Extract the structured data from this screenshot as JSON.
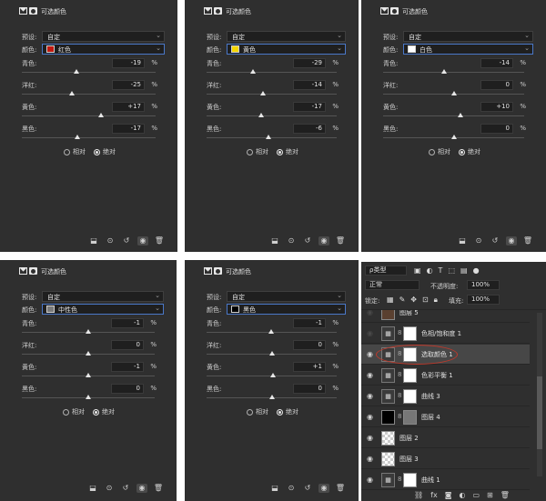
{
  "panels": [
    {
      "title": "可选颜色",
      "preset_label": "预设:",
      "preset_value": "自定",
      "color_label": "颜色:",
      "color_value": "红色",
      "swatch": "#c2180f",
      "sliders": [
        {
          "name": "青色:",
          "value": "-19",
          "pct": "%",
          "level": -19
        },
        {
          "name": "洋红:",
          "value": "-25",
          "pct": "%",
          "level": -25
        },
        {
          "name": "黄色:",
          "value": "+17",
          "pct": "%",
          "level": 17
        },
        {
          "name": "黑色:",
          "value": "-17",
          "pct": "%",
          "level": -17
        }
      ],
      "relative": "相对",
      "absolute": "绝对"
    },
    {
      "title": "可选颜色",
      "preset_label": "预设:",
      "preset_value": "自定",
      "color_label": "颜色:",
      "color_value": "黄色",
      "swatch": "#f4d600",
      "sliders": [
        {
          "name": "青色:",
          "value": "-29",
          "pct": "%",
          "level": -29
        },
        {
          "name": "洋红:",
          "value": "-14",
          "pct": "%",
          "level": -14
        },
        {
          "name": "黄色:",
          "value": "-17",
          "pct": "%",
          "level": -17
        },
        {
          "name": "黑色:",
          "value": "-6",
          "pct": "%",
          "level": -6
        }
      ],
      "relative": "相对",
      "absolute": "绝对"
    },
    {
      "title": "可选颜色",
      "preset_label": "预设:",
      "preset_value": "自定",
      "color_label": "颜色:",
      "color_value": "白色",
      "swatch": "#ffffff",
      "sliders": [
        {
          "name": "青色:",
          "value": "-14",
          "pct": "%",
          "level": -14
        },
        {
          "name": "洋红:",
          "value": "0",
          "pct": "%",
          "level": 0
        },
        {
          "name": "黄色:",
          "value": "+10",
          "pct": "%",
          "level": 10
        },
        {
          "name": "黑色:",
          "value": "0",
          "pct": "%",
          "level": 0
        }
      ],
      "relative": "相对",
      "absolute": "绝对"
    },
    {
      "title": "可选颜色",
      "preset_label": "预设:",
      "preset_value": "自定",
      "color_label": "颜色:",
      "color_value": "中性色",
      "swatch": "#7a7a7a",
      "sliders": [
        {
          "name": "青色:",
          "value": "-1",
          "pct": "%",
          "level": -1
        },
        {
          "name": "洋红:",
          "value": "0",
          "pct": "%",
          "level": 0
        },
        {
          "name": "黄色:",
          "value": "-1",
          "pct": "%",
          "level": -1
        },
        {
          "name": "黑色:",
          "value": "0",
          "pct": "%",
          "level": 0
        }
      ],
      "relative": "相对",
      "absolute": "绝对"
    },
    {
      "title": "可选颜色",
      "preset_label": "预设:",
      "preset_value": "自定",
      "color_label": "颜色:",
      "color_value": "黑色",
      "swatch": "#000000",
      "sliders": [
        {
          "name": "青色:",
          "value": "-1",
          "pct": "%",
          "level": -1
        },
        {
          "name": "洋红:",
          "value": "0",
          "pct": "%",
          "level": 0
        },
        {
          "name": "黄色:",
          "value": "+1",
          "pct": "%",
          "level": 1
        },
        {
          "name": "黑色:",
          "value": "0",
          "pct": "%",
          "level": 0
        }
      ],
      "relative": "相对",
      "absolute": "绝对"
    }
  ],
  "layers_panel": {
    "filter_label": "ρ类型",
    "blend_mode": "正常",
    "opacity_label": "不透明度:",
    "opacity_value": "100%",
    "lock_label": "锁定:",
    "fill_label": "填充:",
    "fill_value": "100%",
    "layers": [
      {
        "name": "图层 5",
        "kind": "photo",
        "visible": false
      },
      {
        "name": "色相/饱和度 1",
        "kind": "adjust",
        "visible": false
      },
      {
        "name": "选取颜色 1",
        "kind": "adjust",
        "visible": true,
        "selected": true
      },
      {
        "name": "色彩平衡 1",
        "kind": "adjust",
        "visible": true
      },
      {
        "name": "曲线 3",
        "kind": "adjust",
        "visible": true
      },
      {
        "name": "图层 4",
        "kind": "photo",
        "visible": true
      },
      {
        "name": "图层 2",
        "kind": "checker",
        "visible": true
      },
      {
        "name": "图层 3",
        "kind": "checker",
        "visible": true
      },
      {
        "name": "曲线 1",
        "kind": "adjust",
        "visible": true
      }
    ],
    "footer_icons": [
      "link-icon",
      "fx-icon",
      "mask-icon",
      "adjustment-icon",
      "folder-icon",
      "new-layer-icon",
      "trash-icon"
    ]
  }
}
